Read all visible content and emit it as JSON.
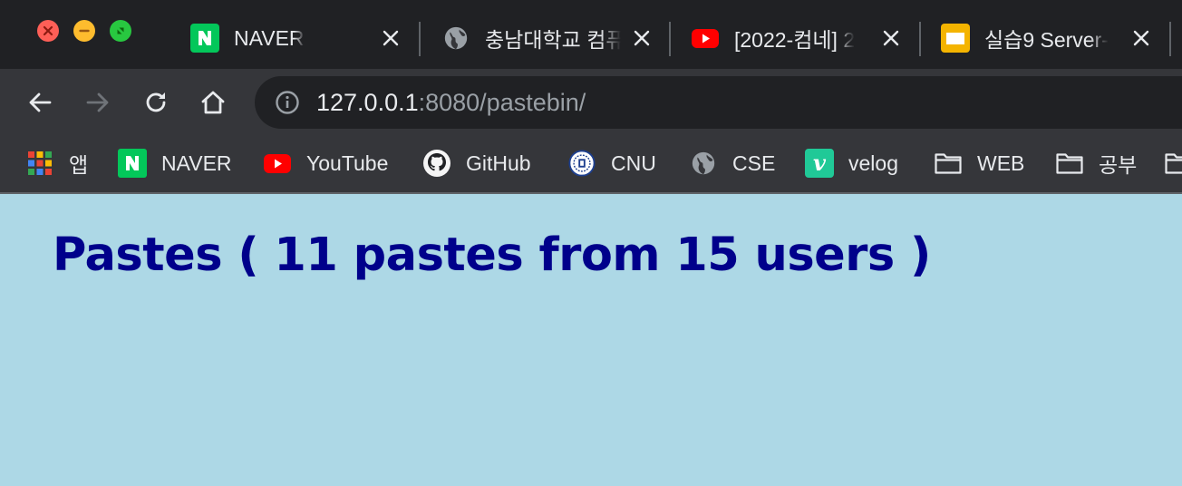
{
  "window": {
    "controls": [
      "close",
      "minimize",
      "fullscreen"
    ],
    "colors": {
      "close": "#fe5f57",
      "minimize": "#febc2e",
      "fullscreen": "#28c840"
    }
  },
  "tabs": [
    {
      "title": "NAVER",
      "favicon": "naver-icon",
      "close_label": "×"
    },
    {
      "title": "충남대학교 컴퓨",
      "favicon": "globe-icon",
      "close_label": "×"
    },
    {
      "title": "[2022-컴네] 2",
      "favicon": "youtube-icon",
      "close_label": "×"
    },
    {
      "title": "실습9 Server-",
      "favicon": "slides-icon",
      "close_label": "×"
    }
  ],
  "toolbar": {
    "back_icon": "back-arrow-icon",
    "forward_icon": "forward-arrow-icon",
    "reload_icon": "reload-icon",
    "home_icon": "home-icon",
    "url_host": "127.0.0.1",
    "url_rest": ":8080/pastebin/"
  },
  "bookmarks": [
    {
      "label": "앱",
      "icon": "apps-grid-icon"
    },
    {
      "label": "NAVER",
      "icon": "naver-icon"
    },
    {
      "label": "YouTube",
      "icon": "youtube-icon"
    },
    {
      "label": "GitHub",
      "icon": "github-icon"
    },
    {
      "label": "CNU",
      "icon": "cnu-emblem-icon"
    },
    {
      "label": "CSE",
      "icon": "globe-icon"
    },
    {
      "label": "velog",
      "icon": "velog-icon"
    },
    {
      "label": "WEB",
      "icon": "folder-icon"
    },
    {
      "label": "공부",
      "icon": "folder-icon"
    }
  ],
  "page": {
    "background": "#add8e6",
    "title": "Pastes ( 11 pastes from 15 users )",
    "title_color": "#00008b"
  }
}
